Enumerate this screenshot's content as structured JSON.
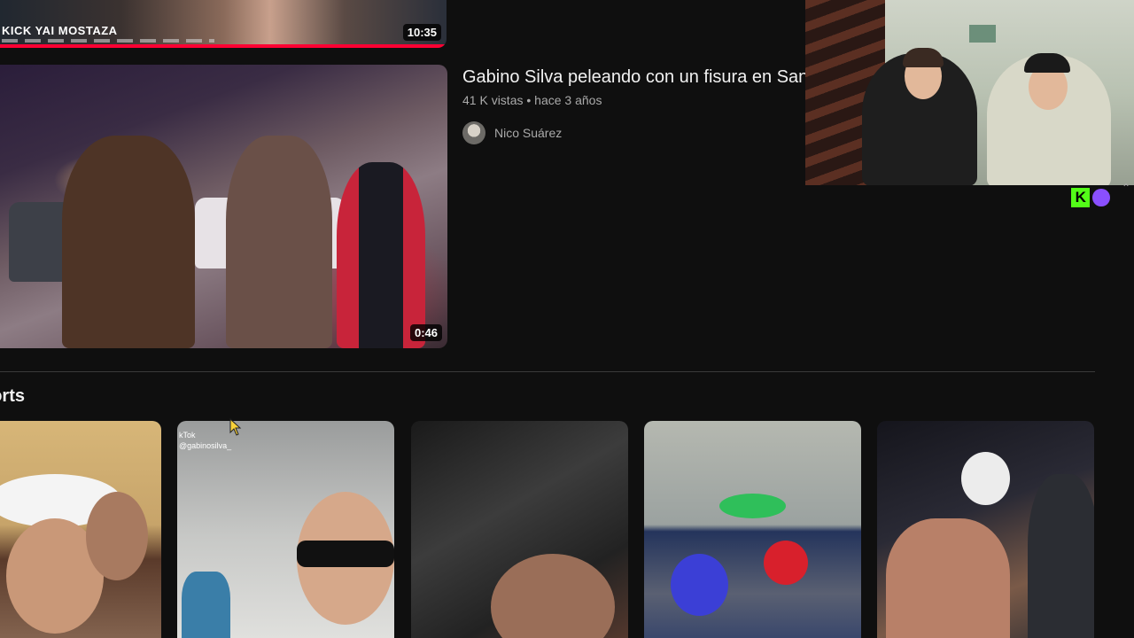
{
  "top_video": {
    "sponsor_text": "KICK YAI MOSTAZA",
    "duration": "10:35",
    "watched_fraction": 1.0
  },
  "main_video": {
    "title": "Gabino Silva peleando con un fisura en San",
    "stats": "41 K vistas • hace 3 años",
    "channel": "Nico Suárez",
    "duration": "0:46"
  },
  "shorts": {
    "title": "horts",
    "items": [
      {
        "id": 1
      },
      {
        "id": 2,
        "overlay_text": "kTok @gabinosilva_"
      },
      {
        "id": 3
      },
      {
        "id": 4
      },
      {
        "id": 5
      }
    ]
  },
  "overlay": {
    "webcam_label": "webcam-stream",
    "badge_letter": "K"
  },
  "colors": {
    "background": "#0f0f0f",
    "progress": "#ff0033",
    "kick_green": "#53fc18"
  }
}
